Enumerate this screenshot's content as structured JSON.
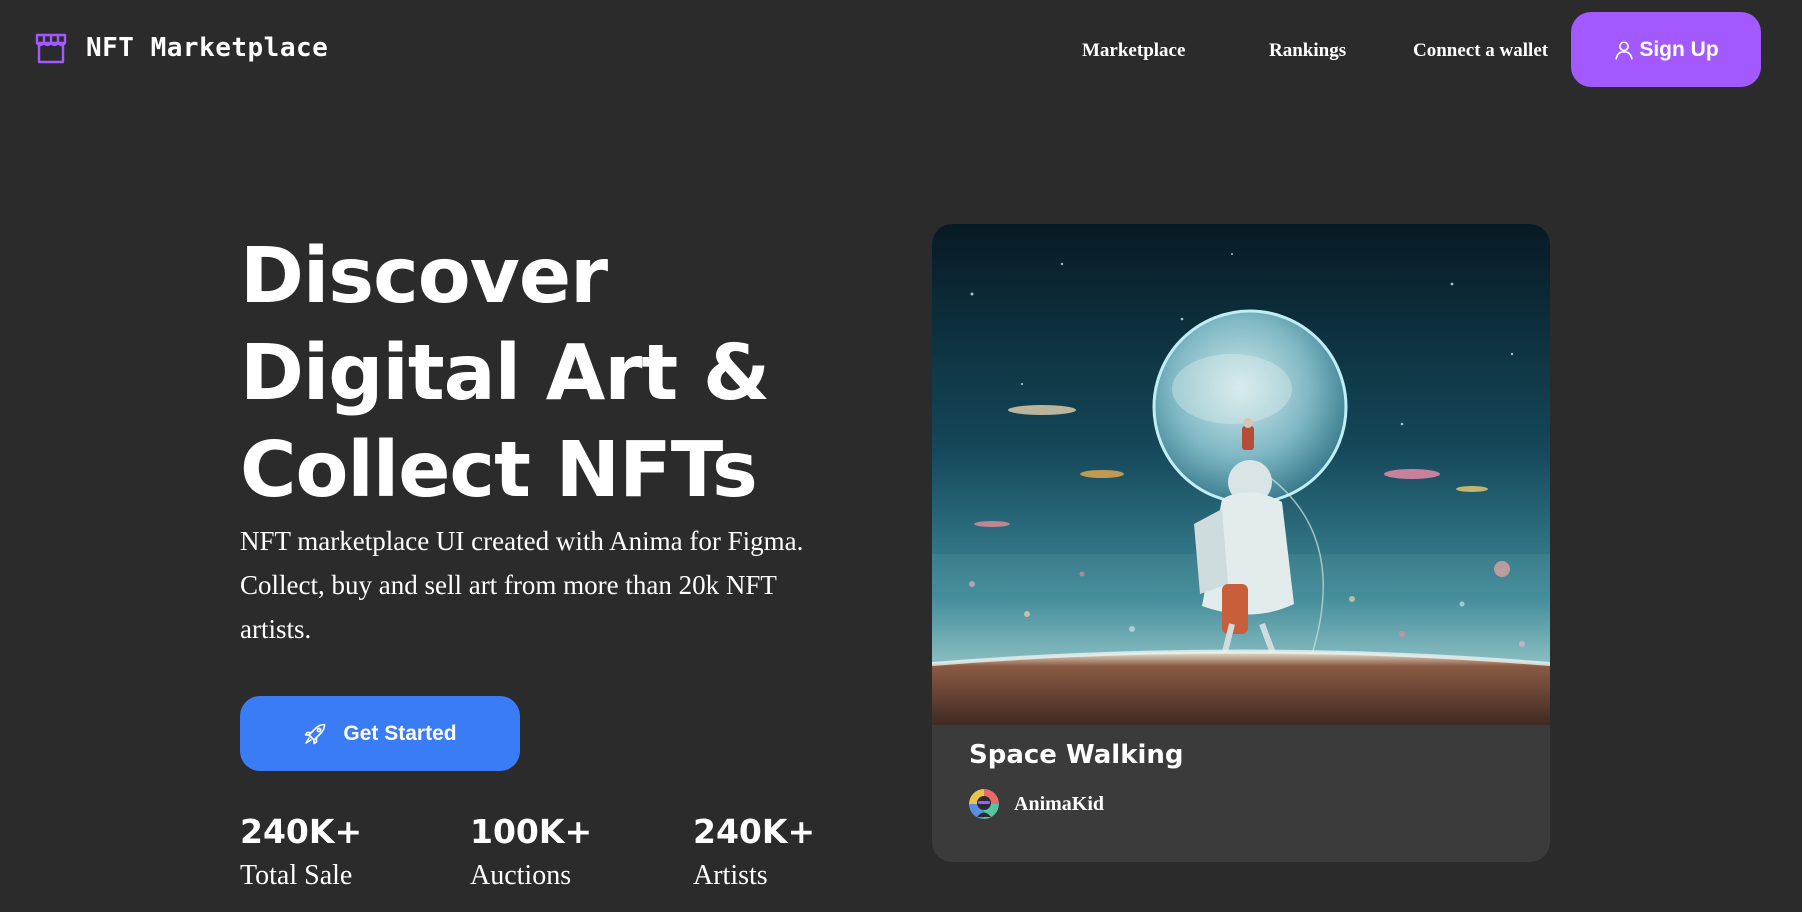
{
  "header": {
    "logo_text": "NFT Marketplace",
    "logo_icon": "storefront-icon",
    "nav": {
      "marketplace": "Marketplace",
      "rankings": "Rankings",
      "connect_wallet": "Connect a wallet"
    },
    "signup": {
      "label": "Sign Up",
      "icon": "user-icon"
    }
  },
  "hero": {
    "title_lines": [
      "Discover",
      "Digital Art &",
      "Collect NFTs"
    ],
    "description": "NFT marketplace UI created with Anima for Figma. Collect, buy and sell art from more than 20k NFT artists.",
    "cta": {
      "label": "Get Started",
      "icon": "rocket-icon"
    },
    "stats": [
      {
        "value": "240K+",
        "label": "Total Sale"
      },
      {
        "value": "100K+",
        "label": "Auctions"
      },
      {
        "value": "240K+",
        "label": "Artists"
      }
    ]
  },
  "featured_card": {
    "title": "Space Walking",
    "artist": "AnimaKid",
    "image": "astronaut-planet-artwork"
  },
  "colors": {
    "background": "#2b2b2b",
    "card_background": "#3b3b3b",
    "accent_purple": "#a259ff",
    "accent_blue": "#3a7bf6",
    "text": "#ffffff"
  }
}
